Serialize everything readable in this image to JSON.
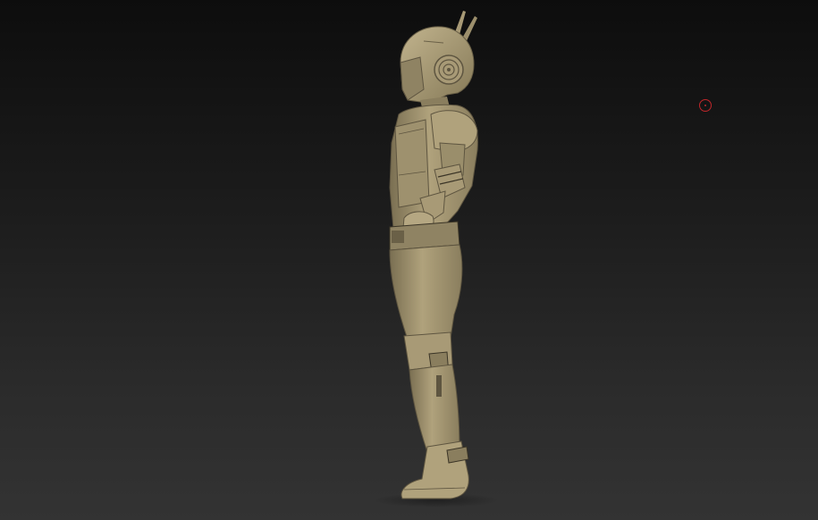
{
  "viewport": {
    "background_top": "#0d0d0d",
    "background_bottom": "#333333"
  },
  "model": {
    "material_color": "#a89a76",
    "shadow_color": "#5e5540",
    "dark_color": "#3a3426",
    "highlight_color": "#c7b993"
  },
  "cursor": {
    "icon": "brush-cursor-icon",
    "color": "#c0262a"
  }
}
